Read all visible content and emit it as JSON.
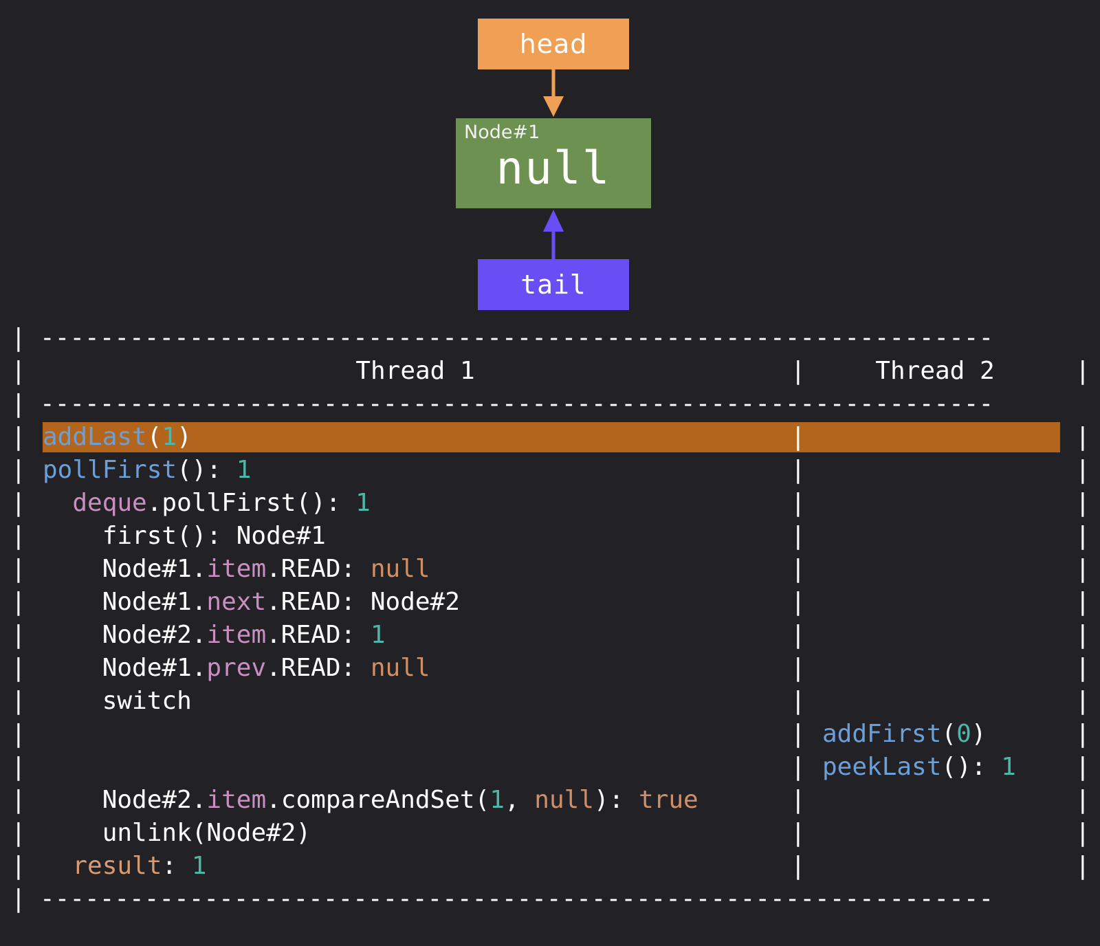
{
  "theme": {
    "background": "#222226",
    "head_color": "#f0a055",
    "tail_color": "#6a4ef5",
    "node_color": "#6d9150",
    "highlight_color": "#b4651c",
    "method_color": "#6c9fd8",
    "number_color": "#4db6a8",
    "field_color": "#c98fc0",
    "literal_color": "#cd9069",
    "text_color": "#ffffff"
  },
  "diagram": {
    "head_label": "head",
    "tail_label": "tail",
    "node": {
      "id_label": "Node#1",
      "value_label": "null"
    }
  },
  "trace": {
    "rail_char": "|",
    "divider": "----------------------------------------------------------------",
    "headers": {
      "thread1": "Thread 1",
      "thread2": "Thread 2"
    },
    "rows": [
      {
        "kind": "divider"
      },
      {
        "kind": "header"
      },
      {
        "kind": "divider"
      },
      {
        "kind": "entry",
        "highlight": true,
        "t1": [
          {
            "text": "addLast",
            "color": "method"
          },
          {
            "text": "(",
            "color": "plain"
          },
          {
            "text": "1",
            "color": "num"
          },
          {
            "text": ")",
            "color": "plain"
          }
        ],
        "t2": []
      },
      {
        "kind": "entry",
        "highlight": false,
        "t1": [
          {
            "text": "pollFirst",
            "color": "method"
          },
          {
            "text": "(): ",
            "color": "plain"
          },
          {
            "text": "1",
            "color": "num"
          }
        ],
        "t2": []
      },
      {
        "kind": "entry",
        "highlight": false,
        "t1": [
          {
            "text": "  ",
            "color": "plain"
          },
          {
            "text": "deque",
            "color": "field"
          },
          {
            "text": ".pollFirst(): ",
            "color": "plain"
          },
          {
            "text": "1",
            "color": "num"
          }
        ],
        "t2": []
      },
      {
        "kind": "entry",
        "highlight": false,
        "t1": [
          {
            "text": "    first(): Node#1",
            "color": "plain"
          }
        ],
        "t2": []
      },
      {
        "kind": "entry",
        "highlight": false,
        "t1": [
          {
            "text": "    Node#1.",
            "color": "plain"
          },
          {
            "text": "item",
            "color": "field"
          },
          {
            "text": ".READ: ",
            "color": "plain"
          },
          {
            "text": "null",
            "color": "null"
          }
        ],
        "t2": []
      },
      {
        "kind": "entry",
        "highlight": false,
        "t1": [
          {
            "text": "    Node#1.",
            "color": "plain"
          },
          {
            "text": "next",
            "color": "field"
          },
          {
            "text": ".READ: Node#2",
            "color": "plain"
          }
        ],
        "t2": []
      },
      {
        "kind": "entry",
        "highlight": false,
        "t1": [
          {
            "text": "    Node#2.",
            "color": "plain"
          },
          {
            "text": "item",
            "color": "field"
          },
          {
            "text": ".READ: ",
            "color": "plain"
          },
          {
            "text": "1",
            "color": "num"
          }
        ],
        "t2": []
      },
      {
        "kind": "entry",
        "highlight": false,
        "t1": [
          {
            "text": "    Node#1.",
            "color": "plain"
          },
          {
            "text": "prev",
            "color": "field"
          },
          {
            "text": ".READ: ",
            "color": "plain"
          },
          {
            "text": "null",
            "color": "null"
          }
        ],
        "t2": []
      },
      {
        "kind": "entry",
        "highlight": false,
        "t1": [
          {
            "text": "    switch",
            "color": "plain"
          }
        ],
        "t2": []
      },
      {
        "kind": "entry",
        "highlight": false,
        "t1": [],
        "t2": [
          {
            "text": "addFirst",
            "color": "method"
          },
          {
            "text": "(",
            "color": "plain"
          },
          {
            "text": "0",
            "color": "num"
          },
          {
            "text": ")",
            "color": "plain"
          }
        ]
      },
      {
        "kind": "entry",
        "highlight": false,
        "t1": [],
        "t2": [
          {
            "text": "peekLast",
            "color": "method"
          },
          {
            "text": "(): ",
            "color": "plain"
          },
          {
            "text": "1",
            "color": "num"
          }
        ]
      },
      {
        "kind": "entry",
        "highlight": false,
        "t1": [
          {
            "text": "    Node#2.",
            "color": "plain"
          },
          {
            "text": "item",
            "color": "field"
          },
          {
            "text": ".compareAndSet(",
            "color": "plain"
          },
          {
            "text": "1",
            "color": "num"
          },
          {
            "text": ", ",
            "color": "plain"
          },
          {
            "text": "null",
            "color": "null"
          },
          {
            "text": "): ",
            "color": "plain"
          },
          {
            "text": "true",
            "color": "null"
          }
        ],
        "t2": []
      },
      {
        "kind": "entry",
        "highlight": false,
        "t1": [
          {
            "text": "    unlink(Node#2)",
            "color": "plain"
          }
        ],
        "t2": []
      },
      {
        "kind": "entry",
        "highlight": false,
        "t1": [
          {
            "text": "  ",
            "color": "plain"
          },
          {
            "text": "result",
            "color": "result"
          },
          {
            "text": ": ",
            "color": "plain"
          },
          {
            "text": "1",
            "color": "num"
          }
        ],
        "t2": []
      },
      {
        "kind": "divider"
      }
    ]
  }
}
